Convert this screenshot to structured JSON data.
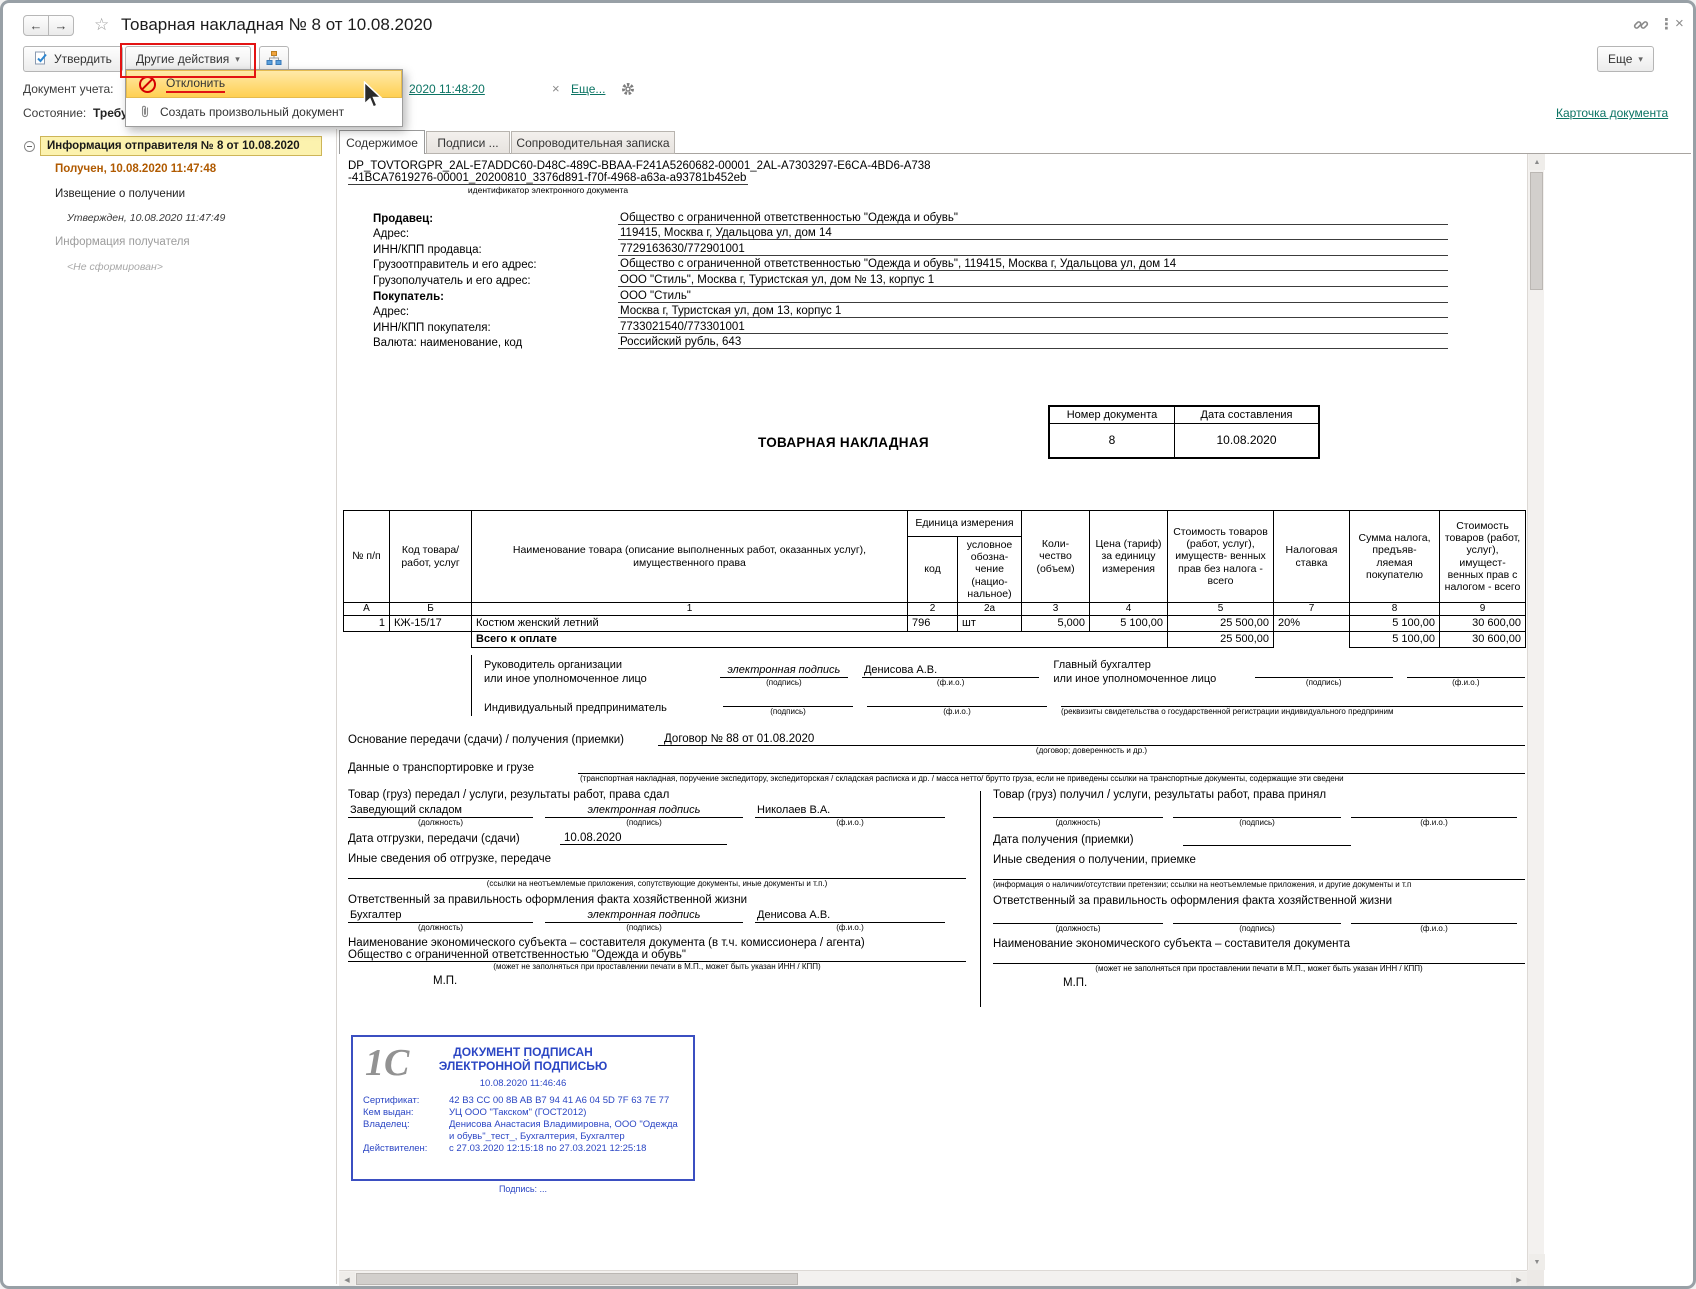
{
  "chrome": {
    "title": "Товарная накладная № 8 от 10.08.2020",
    "back": "←",
    "forward": "→",
    "star": "☆",
    "dots": "⋮",
    "close": "×"
  },
  "toolbar": {
    "approve": "Утвердить",
    "other_actions": "Другие действия",
    "caret": "▾",
    "more": "Еще"
  },
  "menu": {
    "reject": "Отклонить",
    "create_doc": "Создать произвольный документ"
  },
  "meta": {
    "doc_label": "Документ учета:",
    "doc_link_tail": "2020 11:48:20",
    "clear_x": "×",
    "more_link": "Еще...",
    "state_label": "Состояние:",
    "state_value": "Требу",
    "card_link": "Карточка документа"
  },
  "tree": {
    "item1": "Информация отправителя № 8 от 10.08.2020",
    "item2": "Получен, 10.08.2020 11:47:48",
    "item3": "Извещение о получении",
    "item4": "Утвержден, 10.08.2020 11:47:49",
    "item5": "Информация получателя",
    "item6": "<Не сформирован>"
  },
  "tabs": {
    "content": "Содержимое",
    "signatures": "Подписи ...",
    "note": "Сопроводительная записка"
  },
  "doc": {
    "id1": "DP_TOVTORGPR_2AL-E7ADDC60-D48C-489C-BBAA-F241A5260682-00001_2AL-A7303297-E6CA-4BD6-A738",
    "id2": "-41BCA7619276-00001_20200810_3376d891-f70f-4968-a63a-a93781b452eb",
    "id_caption": "идентификатор электронного документа",
    "fields": [
      {
        "label": "Продавец:",
        "value": "Общество с ограниченной ответственностью \"Одежда и обувь\""
      },
      {
        "label": "Адрес:",
        "value": "119415, Москва г, Удальцова ул, дом 14"
      },
      {
        "label": "ИНН/КПП продавца:",
        "value": "7729163630/772901001"
      },
      {
        "label": "Грузоотправитель и его адрес:",
        "value": "Общество с ограниченной ответственностью \"Одежда и обувь\", 119415, Москва г, Удальцова ул, дом 14"
      },
      {
        "label": "Грузополучатель и его адрес:",
        "value": "ООО \"Стиль\", Москва г, Туристская ул, дом № 13, корпус 1"
      },
      {
        "label": "Покупатель:",
        "value": "ООО \"Стиль\""
      },
      {
        "label": "Адрес:",
        "value": "Москва г, Туристская ул, дом 13, корпус 1"
      },
      {
        "label": "ИНН/КПП покупателя:",
        "value": "7733021540/773301001"
      },
      {
        "label": "Валюта: наименование, код",
        "value": "Российский рубль, 643"
      }
    ],
    "form_title": "ТОВАРНАЯ НАКЛАДНАЯ",
    "num_header": "Номер документа",
    "date_header": "Дата составления",
    "number": "8",
    "date": "10.08.2020"
  },
  "goods": {
    "h_num": "№ п/п",
    "h_code": "Код товара/ работ, услуг",
    "h_name": "Наименование товара (описание выполненных работ, оказанных услуг), имущественного права",
    "h_unit": "Единица измерения",
    "h_unit_code": "код",
    "h_unit_sym": "условное обозна- чение (нацио- нальное)",
    "h_qty": "Коли- чество (объем)",
    "h_price": "Цена (тариф) за единицу измерения",
    "h_amount": "Стоимость товаров (работ, услуг), имуществ- венных прав без налога - всего",
    "h_tax_rate": "Налоговая ставка",
    "h_tax_sum": "Сумма налога, предъяв- ляемая покупателю",
    "h_total": "Стоимость товаров (работ, услуг), имущест- венных прав с налогом - всего",
    "letters": [
      "А",
      "Б",
      "1",
      "2",
      "2а",
      "3",
      "4",
      "5",
      "7",
      "8",
      "9"
    ],
    "row": [
      "1",
      "КЖ-15/17",
      "Костюм женский летний",
      "796",
      "шт",
      "5,000",
      "5 100,00",
      "25 500,00",
      "20%",
      "5 100,00",
      "30 600,00"
    ],
    "total_label": "Всего к оплате",
    "total_amount": "25 500,00",
    "total_tax": "5 100,00",
    "total_with_tax": "30 600,00"
  },
  "sign": {
    "head1": "Руководитель организации",
    "head2": "или иное уполномоченное лицо",
    "esign": "электронная подпись",
    "head_name": "Денисова А.В.",
    "acc1": "Главный бухгалтер",
    "acc2": "или иное уполномоченное лицо",
    "ip": "Индивидуальный предприниматель",
    "cap_sign": "(подпись)",
    "cap_name": "(ф.и.о.)",
    "cap_reg": "(реквизиты свидетельства о государственной  регистрации индивидуального предприним"
  },
  "transfer": {
    "basis_label": "Основание передачи (сдачи) / получения (приемки)",
    "basis_value": "Договор № 88 от 01.08.2020",
    "basis_cap": "(договор; доверенность и др.)",
    "cargo_label": "Данные о транспортировке и грузе",
    "cargo_cap": "(транспортная накладная, поручение экспедитору, экспедиторская / складская расписка и др. / масса нетто/ брутто груза, если не приведены ссылки на транспортные документы, содержащие эти сведени"
  },
  "left": {
    "title": "Товар (груз) передал / услуги, результаты работ, права сдал",
    "position": "Заведующий складом",
    "sign": "электронная подпись",
    "name": "Николаев В.А.",
    "cap_pos": "(должность)",
    "cap_sign": "(подпись)",
    "cap_name": "(ф.и.о.)",
    "date_label": "Дата отгрузки, передачи (сдачи)",
    "date_value": "10.08.2020",
    "other": "Иные сведения об отгрузке, передаче",
    "other_cap": "(ссылки на неотъемлемые приложения, сопутствующие документы, иные документы и т.п.)",
    "resp": "Ответственный за правильность оформления факта хозяйственной жизни",
    "resp_pos": "Бухгалтер",
    "resp_sign": "электронная подпись",
    "resp_name": "Денисова А.В.",
    "entity_label": "Наименование экономического субъекта – составителя документа (в т.ч. комиссионера / агента)",
    "entity_value": "Общество с ограниченной ответственностью \"Одежда и обувь\"",
    "entity_cap": "(может не заполняться при проставлении печати в М.П., может быть указан ИНН / КПП)",
    "mp": "М.П."
  },
  "right": {
    "title": "Товар (груз) получил / услуги, результаты работ, права принял",
    "cap_pos": "(должность)",
    "cap_sign": "(подпись)",
    "cap_name": "(ф.и.о.)",
    "date_label": "Дата получения (приемки)",
    "other": "Иные сведения о получении, приемке",
    "other_cap": "(информация о наличии/отсутствии претензии; ссылки на неотъемлемые приложения, и другие  документы и т.п",
    "resp": "Ответственный за правильность оформления факта хозяйственной жизни",
    "entity_label": "Наименование экономического субъекта – составителя документа",
    "entity_cap": "(может не заполняться при проставлении печати в М.П., может быть указан ИНН / КПП)",
    "mp": "М.П."
  },
  "stamp": {
    "logo": "1С",
    "line1": "ДОКУМЕНТ ПОДПИСАН",
    "line2": "ЭЛЕКТРОННОЙ ПОДПИСЬЮ",
    "datetime": "10.08.2020 11:46:46",
    "cert_label": "Сертификат:",
    "cert": "42 B3 CC 00 8B AB B7 94 41 A6 04 5D 7F 63 7E 77",
    "issuer_label": "Кем выдан:",
    "issuer": "УЦ ООО \"Такском\" (ГОСТ2012)",
    "owner_label": "Владелец:",
    "owner": "Денисова Анастасия Владимировна, ООО \"Одежда и обувь\"_тест_, Бухгалтерия, Бухгалтер",
    "valid_label": "Действителен:",
    "valid": "с 27.03.2020 12:15:18 по 27.03.2021 12:25:18",
    "footer": "Подпись: ..."
  }
}
